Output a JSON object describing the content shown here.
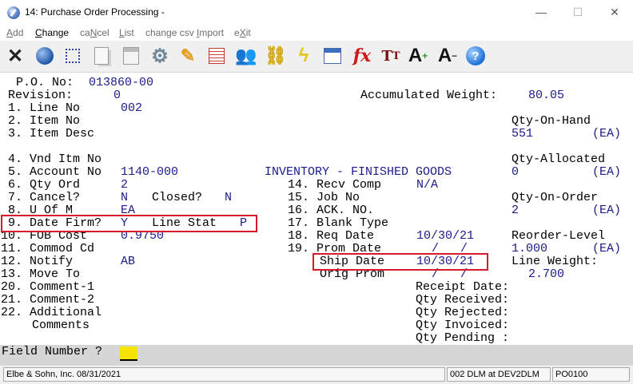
{
  "window": {
    "title": "14: Purchase Order Processing -",
    "minimize": "—",
    "maximize": "☐",
    "close": "✕"
  },
  "menu": {
    "items": [
      {
        "label": "Add",
        "u": "A",
        "rest": "dd",
        "active": false
      },
      {
        "label": "Change",
        "u": "C",
        "rest": "hange",
        "active": true
      },
      {
        "label": "caNcel",
        "pre": "ca",
        "u": "N",
        "rest": "cel",
        "active": false
      },
      {
        "label": "List",
        "u": "L",
        "rest": "ist",
        "active": false
      },
      {
        "label": "change csv Import",
        "pre": "change csv ",
        "u": "I",
        "rest": "mport",
        "active": false
      },
      {
        "label": "eXit",
        "pre": "e",
        "u": "X",
        "rest": "it",
        "active": false
      }
    ]
  },
  "toolbar": {
    "icons": [
      "close-icon",
      "globe-icon",
      "select-icon",
      "copy-icon",
      "paste-icon",
      "settings-icon",
      "edit-icon",
      "spreadsheet-icon",
      "users-icon",
      "link-icon",
      "lightning-icon",
      "chart-icon",
      "function-icon",
      "font-size-icon",
      "font-increase-icon",
      "font-decrease-icon",
      "help-icon"
    ]
  },
  "screen": {
    "po_label": "P.O. No:",
    "po_value": "013860-00",
    "revision_label": "Revision:",
    "revision_value": "0",
    "acc_weight_label": "Accumulated Weight:",
    "acc_weight_value": "80.05",
    "f1_label": "1. Line No",
    "f1_value": "002",
    "f2_label": "2. Item No",
    "f3_label": "3. Item Desc",
    "f4_label": "4. Vnd Itm No",
    "f5_label": "5. Account No",
    "f5_value": "1140-000",
    "f5_desc": "INVENTORY - FINISHED GOODS",
    "f6_label": "6. Qty Ord",
    "f6_value": "2",
    "f7_label": "7. Cancel?",
    "f7_value": "N",
    "closed_label": "Closed?",
    "closed_value": "N",
    "f8_label": "8. U Of M",
    "f8_value": "EA",
    "f9_label": "9. Date Firm?",
    "f9_value": "Y",
    "line_stat_label": "Line Stat",
    "line_stat_value": "P",
    "f10_label": "10. FOB Cost",
    "f10_value": "0.9750",
    "f11_label": "11. Commod Cd",
    "f12_label": "12. Notify",
    "f12_value": "AB",
    "f13_label": "13. Move To",
    "f20_label": "20. Comment-1",
    "f21_label": "21. Comment-2",
    "f22_label": "22. Additional",
    "f22_label2": "Comments",
    "f14_label": "14. Recv Comp",
    "f14_value": "N/A",
    "f15_label": "15. Job No",
    "f16_label": "16. ACK. NO.",
    "f17_label": "17. Blank Type",
    "f18_label": "18. Req Date",
    "f18_value": "10/30/21",
    "f19_label": "19. Prom Date",
    "f19_value": "/   /",
    "ship_label": "Ship Date",
    "ship_value": "10/30/21",
    "orig_label": "Orig Prom",
    "orig_value": "/   /",
    "qoh_label": "Qty-On-Hand",
    "qoh_value": "551",
    "qoh_unit": "(EA)",
    "qalloc_label": "Qty-Allocated",
    "qalloc_value": "0",
    "qalloc_unit": "(EA)",
    "qoo_label": "Qty-On-Order",
    "qoo_value": "2",
    "qoo_unit": "(EA)",
    "reorder_label": "Reorder-Level",
    "reorder_value": "1.000",
    "reorder_unit": "(EA)",
    "line_weight_label": "Line Weight:",
    "line_weight_value": "2.700",
    "receipt_date_label": "Receipt Date:",
    "qty_received_label": "Qty Received:",
    "qty_rejected_label": "Qty Rejected:",
    "qty_invoiced_label": "Qty Invoiced:",
    "qty_pending_label": "Qty Pending :"
  },
  "command": {
    "label": "Field Number ?",
    "value": ""
  },
  "status": {
    "company": "Elbe & Sohn, Inc. 08/31/2021",
    "session": "002 DLM at DEV2DLM",
    "program": "PO0100"
  },
  "colors": {
    "value_text": "#1b1b8c",
    "highlight_border": "#d81a2a",
    "input_bg": "#f4e400"
  }
}
